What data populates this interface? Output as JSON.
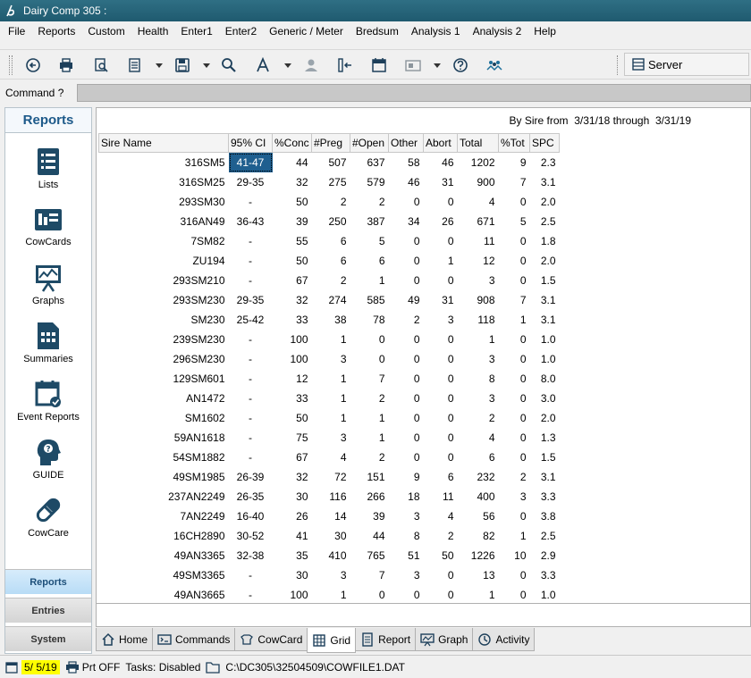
{
  "window": {
    "title": "Dairy Comp 305 :"
  },
  "menu": [
    "File",
    "Reports",
    "Custom",
    "Health",
    "Enter1",
    "Enter2",
    "Generic / Meter",
    "Bredsum",
    "Analysis 1",
    "Analysis 2",
    "Help"
  ],
  "toolbar": {
    "icons": [
      "back-circle-icon",
      "print-icon",
      "print-preview-icon",
      "report-icon",
      "save-icon",
      "search-icon",
      "font-icon",
      "user-icon",
      "insert-column-icon",
      "calendar-icon",
      "id-card-icon",
      "help-icon",
      "group-icon"
    ],
    "server_label": "Server"
  },
  "command": {
    "label": "Command ?",
    "value": ""
  },
  "sidebar": {
    "header": "Reports",
    "items": [
      {
        "label": "Lists",
        "icon": "list-icon"
      },
      {
        "label": "CowCards",
        "icon": "cowcard-icon"
      },
      {
        "label": "Graphs",
        "icon": "graph-icon"
      },
      {
        "label": "Summaries",
        "icon": "summary-icon"
      },
      {
        "label": "Event Reports",
        "icon": "event-calendar-icon"
      },
      {
        "label": "GUIDE",
        "icon": "guide-head-icon"
      },
      {
        "label": "CowCare",
        "icon": "capsule-icon"
      }
    ],
    "tabs": [
      "Reports",
      "Entries",
      "System"
    ]
  },
  "report": {
    "title": "By Sire from  3/31/18 through  3/31/19",
    "columns": [
      "Sire Name",
      "95% CI",
      "%Conc",
      "#Preg",
      "#Open",
      "Other",
      "Abort",
      "Total",
      "%Tot",
      "SPC"
    ],
    "rows": [
      [
        "316SM5",
        "41-47",
        "44",
        "507",
        "637",
        "58",
        "46",
        "1202",
        "9",
        "2.3"
      ],
      [
        "316SM25",
        "29-35",
        "32",
        "275",
        "579",
        "46",
        "31",
        "900",
        "7",
        "3.1"
      ],
      [
        "293SM30",
        "-",
        "50",
        "2",
        "2",
        "0",
        "0",
        "4",
        "0",
        "2.0"
      ],
      [
        "316AN49",
        "36-43",
        "39",
        "250",
        "387",
        "34",
        "26",
        "671",
        "5",
        "2.5"
      ],
      [
        "7SM82",
        "-",
        "55",
        "6",
        "5",
        "0",
        "0",
        "11",
        "0",
        "1.8"
      ],
      [
        "ZU194",
        "-",
        "50",
        "6",
        "6",
        "0",
        "1",
        "12",
        "0",
        "2.0"
      ],
      [
        "293SM210",
        "-",
        "67",
        "2",
        "1",
        "0",
        "0",
        "3",
        "0",
        "1.5"
      ],
      [
        "293SM230",
        "29-35",
        "32",
        "274",
        "585",
        "49",
        "31",
        "908",
        "7",
        "3.1"
      ],
      [
        "SM230",
        "25-42",
        "33",
        "38",
        "78",
        "2",
        "3",
        "118",
        "1",
        "3.1"
      ],
      [
        "239SM230",
        "-",
        "100",
        "1",
        "0",
        "0",
        "0",
        "1",
        "0",
        "1.0"
      ],
      [
        "296SM230",
        "-",
        "100",
        "3",
        "0",
        "0",
        "0",
        "3",
        "0",
        "1.0"
      ],
      [
        "129SM601",
        "-",
        "12",
        "1",
        "7",
        "0",
        "0",
        "8",
        "0",
        "8.0"
      ],
      [
        "AN1472",
        "-",
        "33",
        "1",
        "2",
        "0",
        "0",
        "3",
        "0",
        "3.0"
      ],
      [
        "SM1602",
        "-",
        "50",
        "1",
        "1",
        "0",
        "0",
        "2",
        "0",
        "2.0"
      ],
      [
        "59AN1618",
        "-",
        "75",
        "3",
        "1",
        "0",
        "0",
        "4",
        "0",
        "1.3"
      ],
      [
        "54SM1882",
        "-",
        "67",
        "4",
        "2",
        "0",
        "0",
        "6",
        "0",
        "1.5"
      ],
      [
        "49SM1985",
        "26-39",
        "32",
        "72",
        "151",
        "9",
        "6",
        "232",
        "2",
        "3.1"
      ],
      [
        "237AN2249",
        "26-35",
        "30",
        "116",
        "266",
        "18",
        "11",
        "400",
        "3",
        "3.3"
      ],
      [
        "7AN2249",
        "16-40",
        "26",
        "14",
        "39",
        "3",
        "4",
        "56",
        "0",
        "3.8"
      ],
      [
        "16CH2890",
        "30-52",
        "41",
        "30",
        "44",
        "8",
        "2",
        "82",
        "1",
        "2.5"
      ],
      [
        "49AN3365",
        "32-38",
        "35",
        "410",
        "765",
        "51",
        "50",
        "1226",
        "10",
        "2.9"
      ],
      [
        "49SM3365",
        "-",
        "30",
        "3",
        "7",
        "3",
        "0",
        "13",
        "0",
        "3.3"
      ],
      [
        "49AN3665",
        "-",
        "100",
        "1",
        "0",
        "0",
        "0",
        "1",
        "0",
        "1.0"
      ]
    ]
  },
  "bottom_tabs": [
    {
      "label": "Home",
      "icon": "home-icon"
    },
    {
      "label": "Commands",
      "icon": "commands-icon"
    },
    {
      "label": "CowCard",
      "icon": "cowcard-tab-icon"
    },
    {
      "label": "Grid",
      "icon": "grid-icon"
    },
    {
      "label": "Report",
      "icon": "report-tab-icon"
    },
    {
      "label": "Graph",
      "icon": "graph-tab-icon"
    },
    {
      "label": "Activity",
      "icon": "activity-icon"
    }
  ],
  "status": {
    "date": "5/ 5/19",
    "print": "Prt OFF",
    "tasks": "Tasks: Disabled",
    "path": "C:\\DC305\\32504509\\COWFILE1.DAT"
  }
}
